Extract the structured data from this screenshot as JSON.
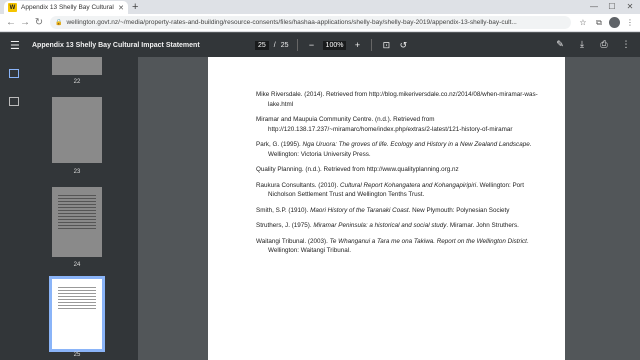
{
  "browser": {
    "tab_title": "Appendix 13 Shelly Bay Cultural I",
    "favicon_letter": "W",
    "url": "wellington.govt.nz/~/media/property-rates-and-building/resource-consents/files/hashaa-applications/shelly-bay/shelly-bay-2019/appendix-13-shelly-bay-cult...",
    "avatar_letter": "●"
  },
  "pdf": {
    "title": "Appendix 13 Shelly Bay Cultural Impact Statement",
    "current_page": "25",
    "page_sep": "/",
    "total_pages": "25",
    "zoom": "100%"
  },
  "thumbnails": [
    {
      "label": "22"
    },
    {
      "label": "23"
    },
    {
      "label": "24"
    },
    {
      "label": "25"
    }
  ],
  "references": [
    {
      "pre": "Mike Riversdale. (2014). Retrieved from http://blog.mikeriversdale.co.nz/2014/08/when-miramar-was-lake.html",
      "ital": "",
      "post": ""
    },
    {
      "pre": "Miramar and Maupuia Community Centre. (n.d.). Retrieved from http://120.138.17.237/~miramarc/home/index.php/extras/2-latest/121-history-of-miramar",
      "ital": "",
      "post": ""
    },
    {
      "pre": "Park, G. (1995). ",
      "ital": "Nga Uruora: The groves of life. Ecology and History in a New Zealand Landscape",
      "post": ". Wellington: Victoria University Press."
    },
    {
      "pre": "Quality Planning. (n.d.). Retrieved from http://www.qualityplanning.org.nz",
      "ital": "",
      "post": ""
    },
    {
      "pre": "Raukura Consultants. (2010). ",
      "ital": "Cultural Report Kohangatera and Kohangapiripiri",
      "post": ". Wellington: Port Nicholson Settlement Trust and Wellington Tenths Trust."
    },
    {
      "pre": "Smith, S.P. (1910). ",
      "ital": "Maori History of the Taranaki Coast",
      "post": ". New Plymouth: Polynesian Society"
    },
    {
      "pre": "Struthers, J. (1975). ",
      "ital": "Miramar Peninsula: a historical and social study",
      "post": ". Miramar. John Struthers."
    },
    {
      "pre": "Waitangi Tribunal. (2003). ",
      "ital": "Te Whanganui a Tara me ona Takiwa. Report on the Wellington District",
      "post": ". Wellington: Waitangi Tribunal."
    }
  ],
  "icons": {
    "back": "back-arrow-icon",
    "forward": "forward-arrow-icon",
    "reload": "reload-icon",
    "menu": "menu-icon",
    "fit": "fit-page-icon",
    "rotate": "rotate-icon",
    "edit": "pen-icon",
    "download": "download-icon",
    "print": "print-icon",
    "more": "more-vert-icon"
  },
  "colors": {
    "toolbar": "#323639",
    "viewer_bg": "#525659",
    "accent": "#8ab4f8"
  }
}
